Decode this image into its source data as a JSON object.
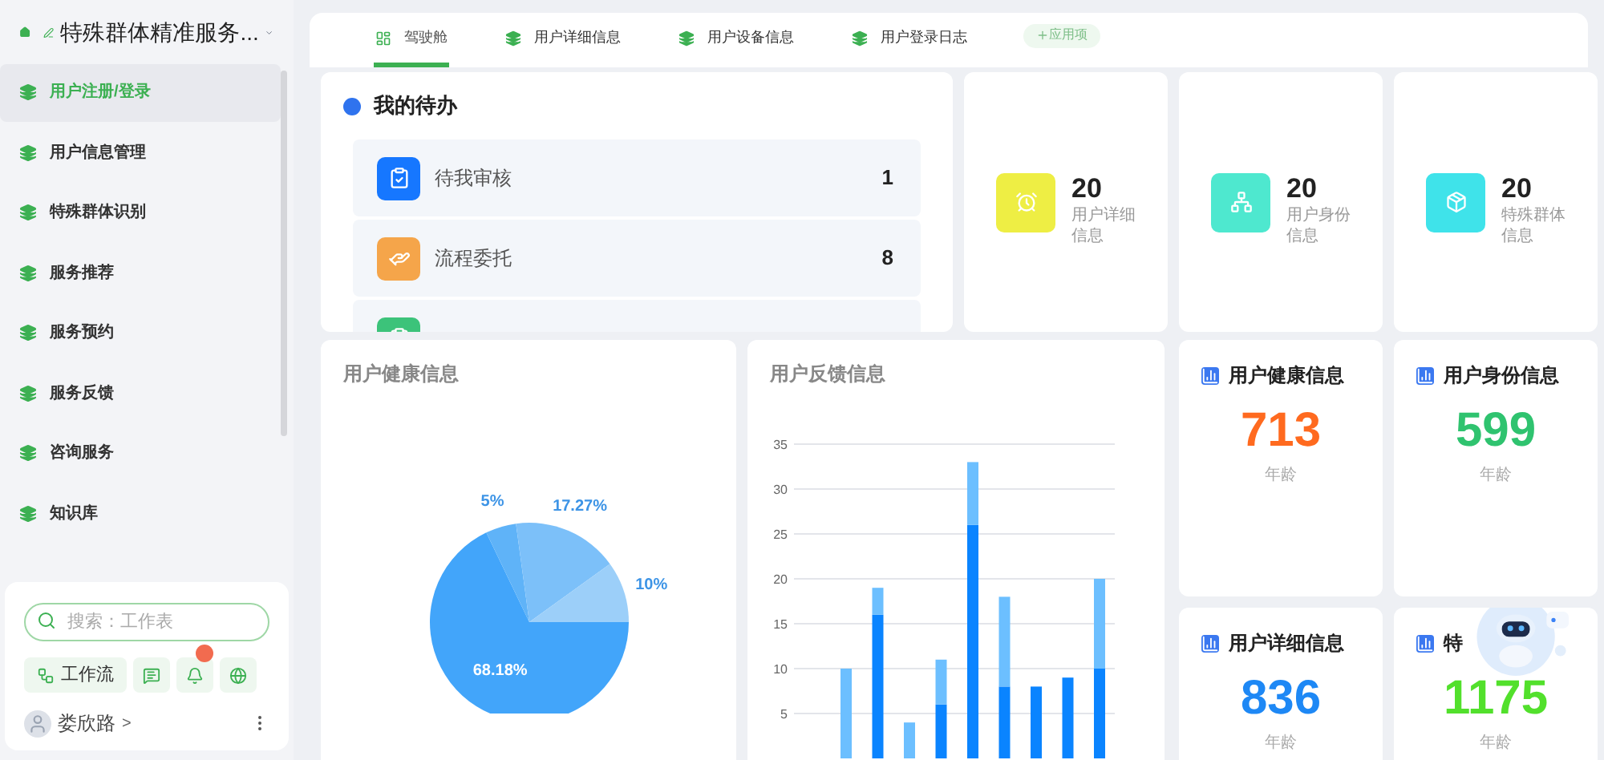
{
  "sidebar": {
    "title": "特殊群体精准服务...",
    "items": [
      {
        "label": "用户注册/登录",
        "selected": true
      },
      {
        "label": "用户信息管理",
        "selected": false
      },
      {
        "label": "特殊群体识别",
        "selected": false
      },
      {
        "label": "服务推荐",
        "selected": false
      },
      {
        "label": "服务预约",
        "selected": false
      },
      {
        "label": "服务反馈",
        "selected": false
      },
      {
        "label": "咨询服务",
        "selected": false
      },
      {
        "label": "知识库",
        "selected": false
      }
    ],
    "search": {
      "placeholder": "搜索：工作表"
    },
    "workflow_button": "工作流",
    "user": {
      "name": "娄欣路",
      "chevron": ">"
    }
  },
  "tabs": [
    {
      "label": "驾驶舱",
      "selected": true
    },
    {
      "label": "用户详细信息",
      "selected": false
    },
    {
      "label": "用户设备信息",
      "selected": false
    },
    {
      "label": "用户登录日志",
      "selected": false
    }
  ],
  "add_app_button": {
    "label": "应用项",
    "disabled": true
  },
  "todo": {
    "title": "我的待办",
    "items": [
      {
        "label": "待我审核",
        "count": "1",
        "color": "#1677ff"
      },
      {
        "label": "流程委托",
        "count": "8",
        "color": "#f5a54a"
      },
      {
        "color": "#3cc37a"
      }
    ]
  },
  "stats": [
    {
      "value": "20",
      "label": "用户详细信息",
      "color": "#eeee44"
    },
    {
      "value": "20",
      "label": "用户身份信息",
      "color": "#4ee8cf"
    },
    {
      "value": "20",
      "label": "特殊群体信息",
      "color": "#3fe3ea"
    }
  ],
  "health_chart": {
    "title": "用户健康信息",
    "chart_data": {
      "type": "pie",
      "values": [
        68.18,
        5,
        17.27,
        10
      ],
      "data_labels": true,
      "value_labels": [
        "68.18%",
        "5%",
        "17.27%",
        "10%"
      ]
    }
  },
  "feedback_chart": {
    "title": "用户反馈信息",
    "chart_data": {
      "type": "bar",
      "stacked": true,
      "ylim": [
        0,
        35
      ],
      "grid": true,
      "yticks": [
        5,
        10,
        15,
        20,
        25,
        30,
        35
      ],
      "series": [
        {
          "color": "#0a84ff",
          "values": [
            0,
            16,
            0,
            6,
            26,
            8,
            8,
            9,
            10
          ]
        },
        {
          "color": "#6cbfff",
          "values": [
            10,
            3,
            4,
            5,
            7,
            10,
            0,
            0,
            10
          ]
        }
      ]
    }
  },
  "info_cards": [
    {
      "title": "用户健康信息",
      "value": "713",
      "unit": "年龄",
      "color": "#ff6a1f"
    },
    {
      "title": "用户身份信息",
      "value": "599",
      "unit": "年龄",
      "color": "#2fc36f"
    },
    {
      "title": "用户详细信息",
      "value": "836",
      "unit": "年龄",
      "color": "#1e88f5"
    },
    {
      "title": "特",
      "value": "1175",
      "unit": "年龄",
      "color": "#52e02c"
    }
  ]
}
